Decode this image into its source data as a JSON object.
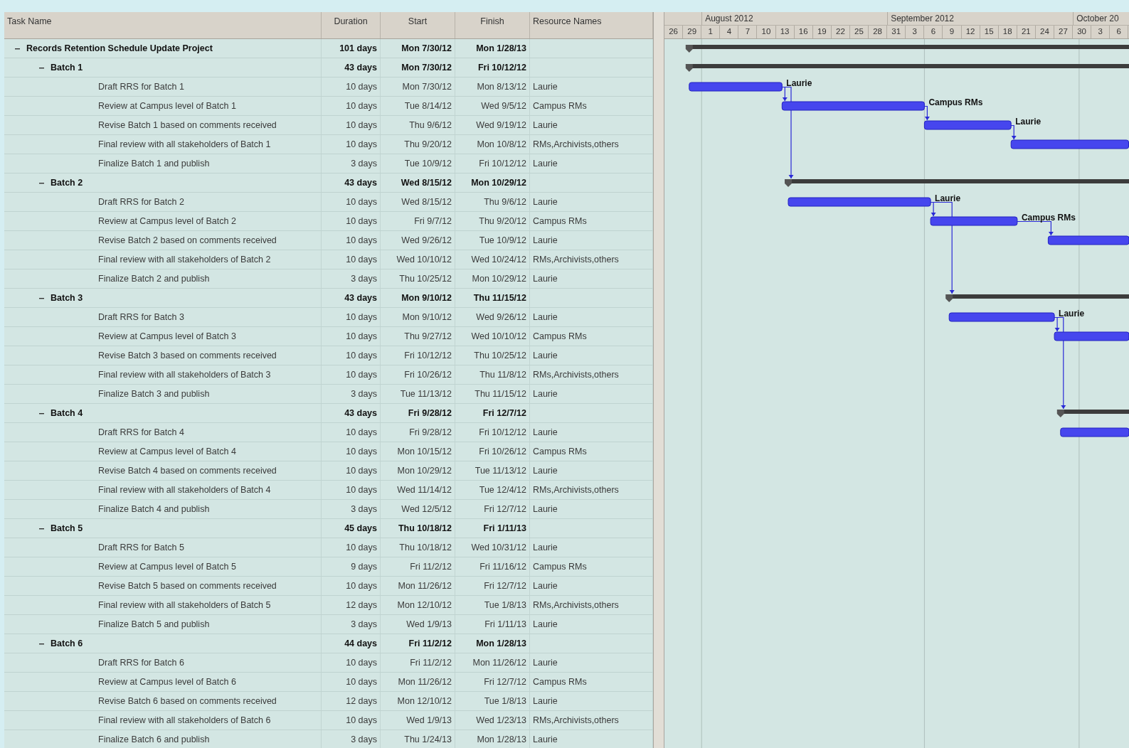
{
  "table": {
    "columns": [
      "Task Name",
      "Duration",
      "Start",
      "Finish",
      "Resource Names"
    ]
  },
  "tasks": [
    {
      "name": "Records Retention Schedule Update Project",
      "duration": "101 days",
      "start": "Mon 7/30/12",
      "finish": "Mon 1/28/13",
      "expanded": true,
      "children": [
        {
          "name": "Batch 1",
          "duration": "43 days",
          "start": "Mon 7/30/12",
          "finish": "Fri 10/12/12",
          "expanded": true,
          "children": [
            {
              "name": "Draft RRS for Batch 1",
              "duration": "10 days",
              "start": "Mon 7/30/12",
              "finish": "Mon 8/13/12",
              "resources": "Laurie",
              "bar_label": "Laurie"
            },
            {
              "name": "Review at Campus level of Batch 1",
              "duration": "10 days",
              "start": "Tue 8/14/12",
              "finish": "Wed 9/5/12",
              "resources": "Campus RMs",
              "bar_label": "Campus RMs"
            },
            {
              "name": "Revise Batch 1 based on comments received",
              "duration": "10 days",
              "start": "Thu 9/6/12",
              "finish": "Wed 9/19/12",
              "resources": "Laurie",
              "bar_label": "Laurie"
            },
            {
              "name": "Final review with all stakeholders of Batch 1",
              "duration": "10 days",
              "start": "Thu 9/20/12",
              "finish": "Mon 10/8/12",
              "resources": "RMs,Archivists,others"
            },
            {
              "name": "Finalize Batch 1 and publish",
              "duration": "3 days",
              "start": "Tue 10/9/12",
              "finish": "Fri 10/12/12",
              "resources": "Laurie"
            }
          ]
        },
        {
          "name": "Batch 2",
          "duration": "43 days",
          "start": "Wed 8/15/12",
          "finish": "Mon 10/29/12",
          "expanded": true,
          "children": [
            {
              "name": "Draft RRS for Batch 2",
              "duration": "10 days",
              "start": "Wed 8/15/12",
              "finish": "Thu 9/6/12",
              "resources": "Laurie",
              "bar_label": "Laurie"
            },
            {
              "name": "Review at Campus level of Batch 2",
              "duration": "10 days",
              "start": "Fri 9/7/12",
              "finish": "Thu 9/20/12",
              "resources": "Campus RMs",
              "bar_label": "Campus RMs"
            },
            {
              "name": "Revise Batch 2 based on comments received",
              "duration": "10 days",
              "start": "Wed 9/26/12",
              "finish": "Tue 10/9/12",
              "resources": "Laurie"
            },
            {
              "name": "Final review with all stakeholders of Batch 2",
              "duration": "10 days",
              "start": "Wed 10/10/12",
              "finish": "Wed 10/24/12",
              "resources": "RMs,Archivists,others"
            },
            {
              "name": "Finalize Batch 2 and publish",
              "duration": "3 days",
              "start": "Thu 10/25/12",
              "finish": "Mon 10/29/12",
              "resources": "Laurie"
            }
          ]
        },
        {
          "name": "Batch 3",
          "duration": "43 days",
          "start": "Mon 9/10/12",
          "finish": "Thu 11/15/12",
          "expanded": true,
          "children": [
            {
              "name": "Draft RRS for Batch 3",
              "duration": "10 days",
              "start": "Mon 9/10/12",
              "finish": "Wed 9/26/12",
              "resources": "Laurie",
              "bar_label": "Laurie"
            },
            {
              "name": "Review at Campus level of Batch 3",
              "duration": "10 days",
              "start": "Thu 9/27/12",
              "finish": "Wed 10/10/12",
              "resources": "Campus RMs"
            },
            {
              "name": "Revise Batch 3 based on comments received",
              "duration": "10 days",
              "start": "Fri 10/12/12",
              "finish": "Thu 10/25/12",
              "resources": "Laurie"
            },
            {
              "name": "Final review with all stakeholders of Batch 3",
              "duration": "10 days",
              "start": "Fri 10/26/12",
              "finish": "Thu 11/8/12",
              "resources": "RMs,Archivists,others"
            },
            {
              "name": "Finalize Batch 3 and publish",
              "duration": "3 days",
              "start": "Tue 11/13/12",
              "finish": "Thu 11/15/12",
              "resources": "Laurie"
            }
          ]
        },
        {
          "name": "Batch 4",
          "duration": "43 days",
          "start": "Fri 9/28/12",
          "finish": "Fri 12/7/12",
          "expanded": true,
          "children": [
            {
              "name": "Draft RRS for Batch 4",
              "duration": "10 days",
              "start": "Fri 9/28/12",
              "finish": "Fri 10/12/12",
              "resources": "Laurie"
            },
            {
              "name": "Review at Campus level of Batch 4",
              "duration": "10 days",
              "start": "Mon 10/15/12",
              "finish": "Fri 10/26/12",
              "resources": "Campus RMs"
            },
            {
              "name": "Revise Batch 4 based on comments received",
              "duration": "10 days",
              "start": "Mon 10/29/12",
              "finish": "Tue 11/13/12",
              "resources": "Laurie"
            },
            {
              "name": "Final review with all stakeholders of Batch 4",
              "duration": "10 days",
              "start": "Wed 11/14/12",
              "finish": "Tue 12/4/12",
              "resources": "RMs,Archivists,others"
            },
            {
              "name": "Finalize Batch 4 and publish",
              "duration": "3 days",
              "start": "Wed 12/5/12",
              "finish": "Fri 12/7/12",
              "resources": "Laurie"
            }
          ]
        },
        {
          "name": "Batch 5",
          "duration": "45 days",
          "start": "Thu 10/18/12",
          "finish": "Fri 1/11/13",
          "expanded": true,
          "children": [
            {
              "name": "Draft RRS for Batch 5",
              "duration": "10 days",
              "start": "Thu 10/18/12",
              "finish": "Wed 10/31/12",
              "resources": "Laurie"
            },
            {
              "name": "Review at Campus level of Batch 5",
              "duration": "9 days",
              "start": "Fri 11/2/12",
              "finish": "Fri 11/16/12",
              "resources": "Campus RMs"
            },
            {
              "name": "Revise Batch 5 based on comments received",
              "duration": "10 days",
              "start": "Mon 11/26/12",
              "finish": "Fri 12/7/12",
              "resources": "Laurie"
            },
            {
              "name": "Final review with all stakeholders of Batch 5",
              "duration": "12 days",
              "start": "Mon 12/10/12",
              "finish": "Tue 1/8/13",
              "resources": "RMs,Archivists,others"
            },
            {
              "name": "Finalize Batch 5 and publish",
              "duration": "3 days",
              "start": "Wed 1/9/13",
              "finish": "Fri 1/11/13",
              "resources": "Laurie"
            }
          ]
        },
        {
          "name": "Batch 6",
          "duration": "44 days",
          "start": "Fri 11/2/12",
          "finish": "Mon 1/28/13",
          "expanded": true,
          "children": [
            {
              "name": "Draft RRS for Batch 6",
              "duration": "10 days",
              "start": "Fri 11/2/12",
              "finish": "Mon 11/26/12",
              "resources": "Laurie"
            },
            {
              "name": "Review at Campus level of Batch 6",
              "duration": "10 days",
              "start": "Mon 11/26/12",
              "finish": "Fri 12/7/12",
              "resources": "Campus RMs"
            },
            {
              "name": "Revise Batch 6 based on comments received",
              "duration": "12 days",
              "start": "Mon 12/10/12",
              "finish": "Tue 1/8/13",
              "resources": "Laurie"
            },
            {
              "name": "Final review with all stakeholders of Batch 6",
              "duration": "10 days",
              "start": "Wed 1/9/13",
              "finish": "Wed 1/23/13",
              "resources": "RMs,Archivists,others"
            },
            {
              "name": "Finalize Batch 6 and publish",
              "duration": "3 days",
              "start": "Thu 1/24/13",
              "finish": "Mon 1/28/13",
              "resources": "Laurie"
            }
          ]
        }
      ]
    }
  ],
  "timescale": {
    "leading_days": [
      "26",
      "29"
    ],
    "months": [
      {
        "label": "August 2012",
        "days": [
          "1",
          "4",
          "7",
          "10",
          "13",
          "16",
          "19",
          "22",
          "25",
          "28"
        ]
      },
      {
        "label": "September 2012",
        "days": [
          "31",
          "3",
          "6",
          "9",
          "12",
          "15",
          "18",
          "21",
          "24",
          "27"
        ]
      },
      {
        "label": "October 20",
        "days": [
          "30",
          "3",
          "6"
        ]
      }
    ]
  }
}
